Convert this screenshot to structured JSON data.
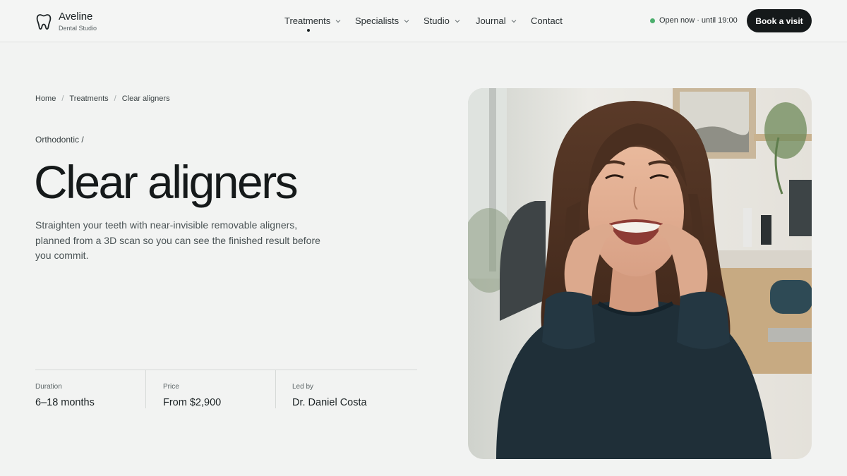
{
  "brand": {
    "name": "Aveline",
    "subtitle": "Dental Studio"
  },
  "nav": {
    "items": [
      {
        "label": "Treatments",
        "has_dropdown": true,
        "active": true
      },
      {
        "label": "Specialists",
        "has_dropdown": true,
        "active": false
      },
      {
        "label": "Studio",
        "has_dropdown": true,
        "active": false
      },
      {
        "label": "Journal",
        "has_dropdown": true,
        "active": false
      },
      {
        "label": "Contact",
        "has_dropdown": false,
        "active": false
      }
    ]
  },
  "status": {
    "text": "Open now · until 19:00",
    "color": "#4caf6d"
  },
  "cta": {
    "label": "Book a visit"
  },
  "breadcrumb": [
    "Home",
    "Treatments",
    "Clear aligners"
  ],
  "page": {
    "kicker": "Orthodontic /",
    "title": "Clear aligners",
    "lead": "Straighten your teeth with near-invisible removable aligners, planned from a 3D scan so you can see the finished result before you commit."
  },
  "facts": [
    {
      "label": "Duration",
      "value": "6–18 months"
    },
    {
      "label": "Price",
      "value": "From $2,900"
    },
    {
      "label": "Led by",
      "value": "Dr. Daniel Costa"
    }
  ],
  "colors": {
    "accent": "#15191a",
    "background": "#f2f3f2"
  }
}
